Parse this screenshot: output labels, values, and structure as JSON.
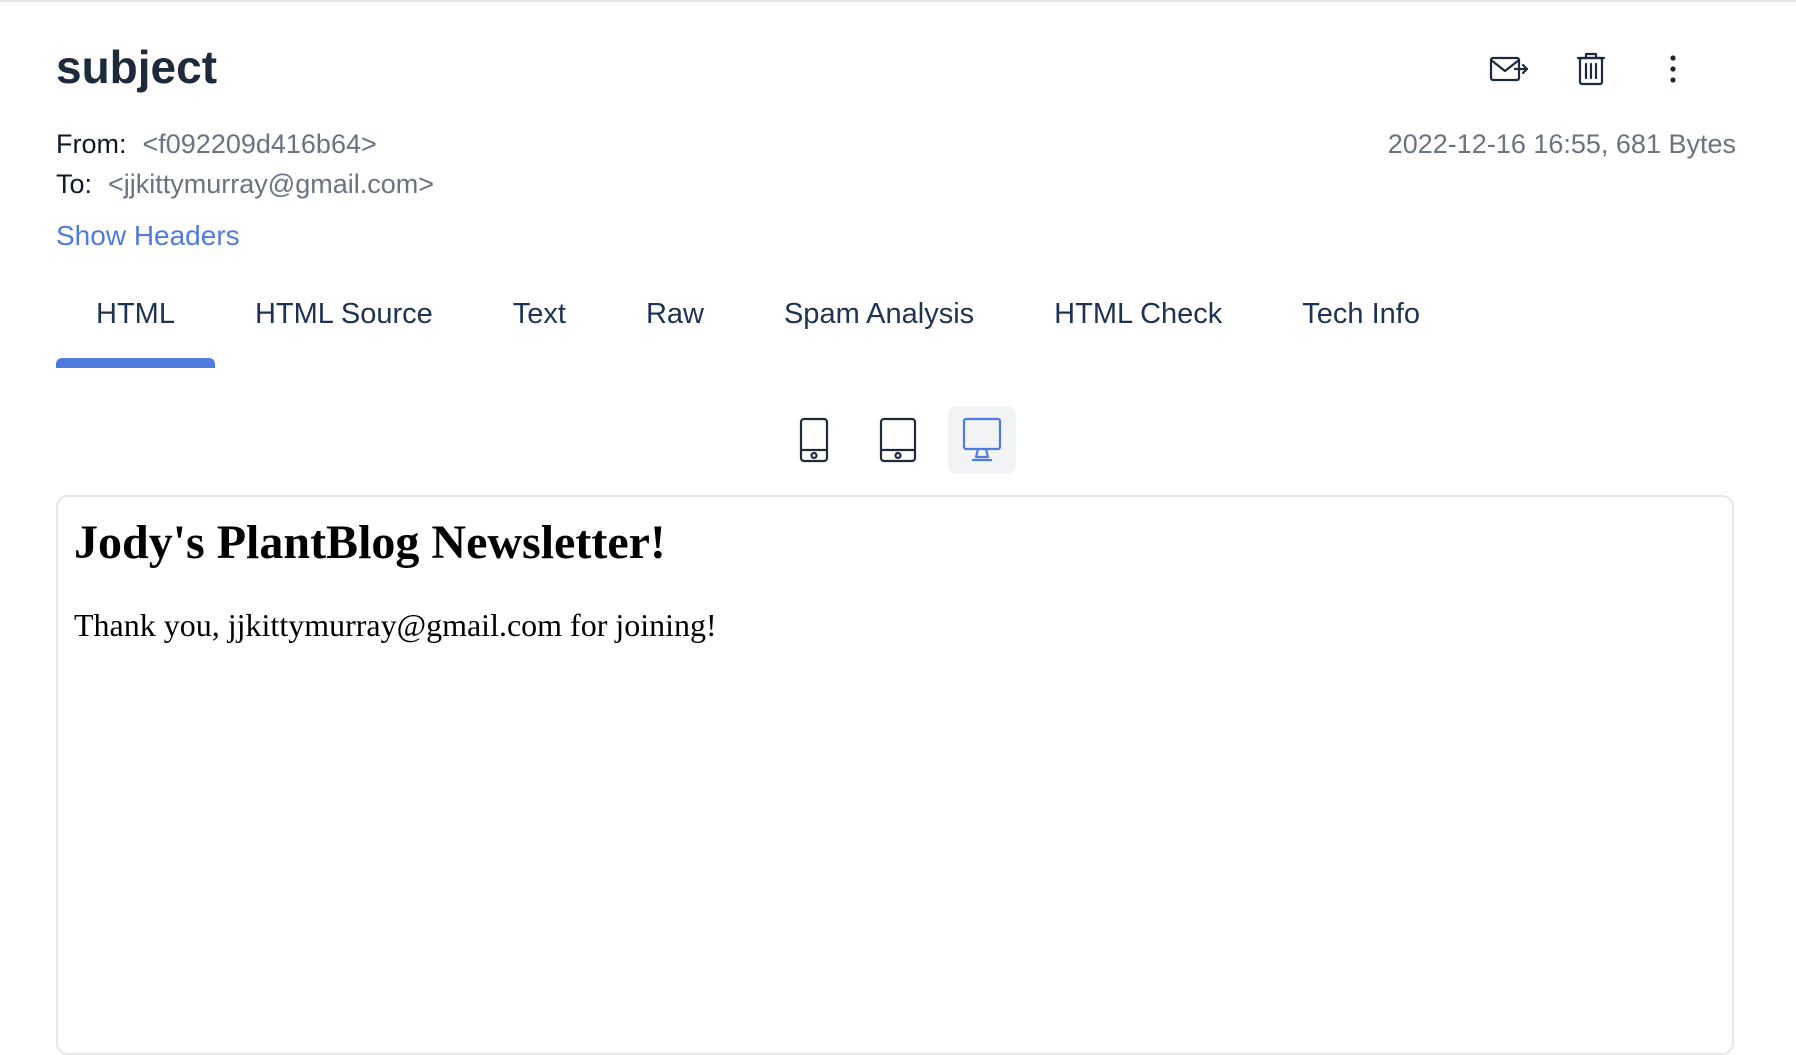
{
  "message": {
    "subject": "subject",
    "from_label": "From:",
    "from_value": "<f092209d416b64>",
    "to_label": "To:",
    "to_value": "<jjkittymurray@gmail.com>",
    "date_size": "2022-12-16 16:55, 681 Bytes",
    "show_headers": "Show Headers"
  },
  "actions": {
    "icons": [
      "forward-mail-icon",
      "trash-icon",
      "more-vertical-icon"
    ]
  },
  "tabs": [
    {
      "label": "HTML",
      "active": true
    },
    {
      "label": "HTML Source",
      "active": false
    },
    {
      "label": "Text",
      "active": false
    },
    {
      "label": "Raw",
      "active": false
    },
    {
      "label": "Spam Analysis",
      "active": false
    },
    {
      "label": "HTML Check",
      "active": false
    },
    {
      "label": "Tech Info",
      "active": false
    }
  ],
  "view_modes": [
    {
      "icon": "phone-icon",
      "selected": false
    },
    {
      "icon": "tablet-icon",
      "selected": false
    },
    {
      "icon": "desktop-icon",
      "selected": true
    }
  ],
  "preview": {
    "heading": "Jody's PlantBlog Newsletter!",
    "body": "Thank you, jjkittymurray@gmail.com for joining!"
  },
  "colors": {
    "accent": "#4f7be0",
    "text_dark": "#1e293b",
    "text_muted": "#6b7280"
  }
}
